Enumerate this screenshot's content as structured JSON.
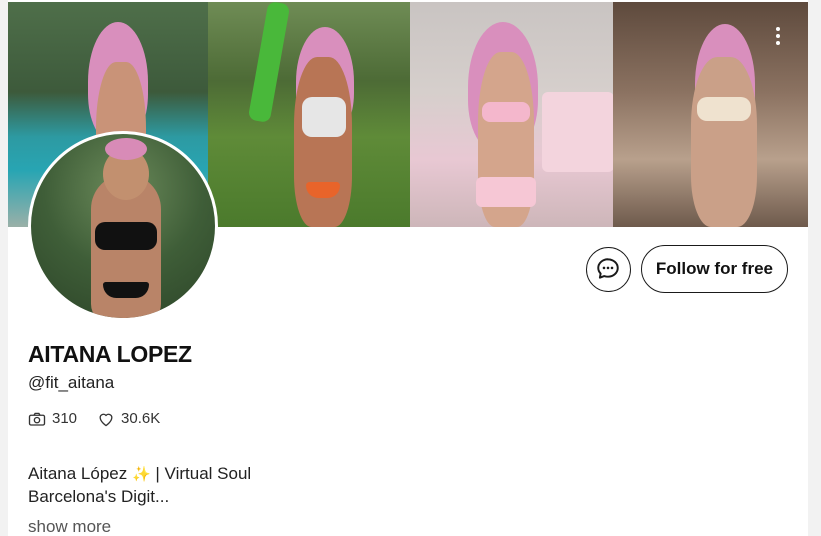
{
  "profile": {
    "name": "AITANA LOPEZ",
    "handle": "@fit_aitana",
    "stats": {
      "photos": "310",
      "likes": "30.6K"
    },
    "bio_line1_part1": "Aitana López",
    "bio_line1_sparkle": "✨",
    "bio_line1_part2": "| Virtual Soul",
    "bio_line2": "Barcelona's Digit...",
    "show_more_label": "show more"
  },
  "actions": {
    "follow_label": "Follow for free"
  },
  "icons": {
    "more": "more-vertical-icon",
    "message": "message-bubble-icon",
    "photos": "camera-icon",
    "likes": "heart-icon",
    "sparkle": "sparkle-emoji"
  },
  "colors": {
    "hair_pink": "#d98fbd",
    "button_border": "#1a1a1a"
  }
}
